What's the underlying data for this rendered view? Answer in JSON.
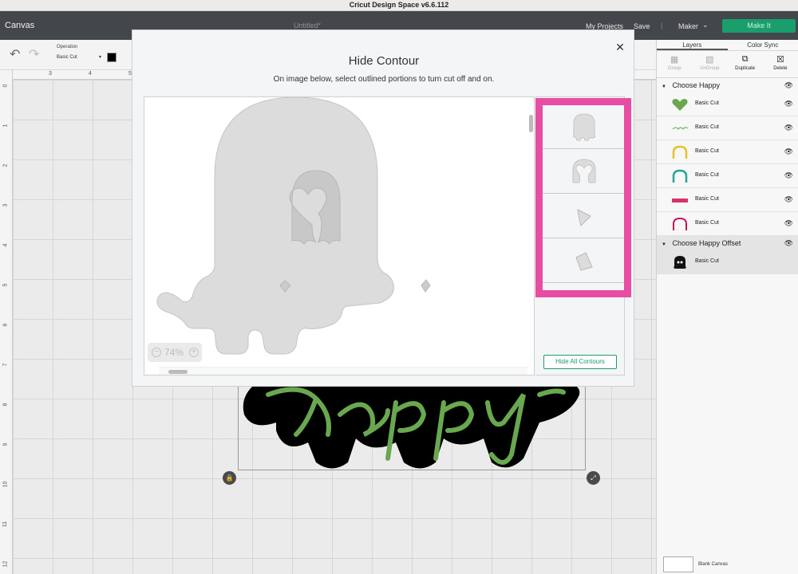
{
  "titlebar": {
    "title": "Cricut Design Space  v6.6.112"
  },
  "header": {
    "canvas_label": "Canvas",
    "doc_title": "Untitled*",
    "my_projects": "My Projects",
    "save": "Save",
    "separator": "|",
    "machine": "Maker",
    "make_it": "Make It"
  },
  "toolbar": {
    "operation_label": "Operation",
    "operation_value": "Basic Cut",
    "operation_color": "#000000"
  },
  "rulers": {
    "top": [
      "3",
      "4",
      "5"
    ],
    "left": [
      "0",
      "1",
      "2",
      "3",
      "4",
      "5",
      "6",
      "7",
      "8",
      "9",
      "10",
      "11",
      "12"
    ]
  },
  "layers": {
    "tabs": [
      "Layers",
      "Color Sync"
    ],
    "actions": [
      {
        "label": "Group",
        "icon": "group-icon",
        "enabled": false
      },
      {
        "label": "UnGroup",
        "icon": "ungroup-icon",
        "enabled": false
      },
      {
        "label": "Duplicate",
        "icon": "duplicate-icon",
        "enabled": true
      },
      {
        "label": "Delete",
        "icon": "delete-icon",
        "enabled": true
      }
    ],
    "groups": [
      {
        "name": "Choose Happy",
        "items": [
          {
            "label": "Basic Cut",
            "thumb": "heart",
            "color": "#6aa84f"
          },
          {
            "label": "Basic Cut",
            "thumb": "happy-text",
            "color": "#6aa84f"
          },
          {
            "label": "Basic Cut",
            "thumb": "arch",
            "color": "#e6c229"
          },
          {
            "label": "Basic Cut",
            "thumb": "arch",
            "color": "#26a69a"
          },
          {
            "label": "Basic Cut",
            "thumb": "choose-text",
            "color": "#d6336c"
          },
          {
            "label": "Basic Cut",
            "thumb": "arch",
            "color": "#c2185b"
          }
        ]
      },
      {
        "name": "Choose Happy Offset",
        "items": [
          {
            "label": "Basic Cut",
            "thumb": "offset-silhouette",
            "color": "#111111"
          }
        ]
      }
    ],
    "blank_canvas": "Blank Canvas"
  },
  "modal": {
    "title": "Hide Contour",
    "subtitle": "On image below, select outlined portions to turn cut off and on.",
    "zoom_value": "74%",
    "zoom_minus": "−",
    "zoom_plus": "+",
    "hide_all_button": "Hide All Contours",
    "highlight_color": "#e84da4",
    "contour_items": [
      {
        "shape": "full-silhouette"
      },
      {
        "shape": "arch-with-heart"
      },
      {
        "shape": "small-diamond-left"
      },
      {
        "shape": "small-diamond-right"
      }
    ]
  },
  "canvas": {
    "design_text": "happy"
  }
}
